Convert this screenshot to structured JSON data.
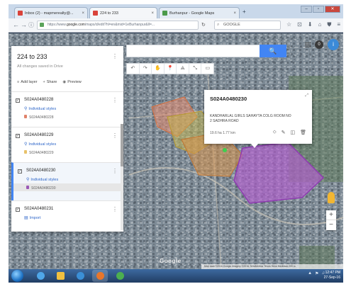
{
  "browser": {
    "tabs": [
      {
        "label": "Inbox (2) - mapmerealty@...",
        "color": "#d9433a"
      },
      {
        "label": "224 to 233",
        "color": "#d9433a"
      },
      {
        "label": "Burhanpur - Google Maps",
        "color": "#4b9a4b"
      }
    ],
    "new_tab": "+",
    "window_buttons": [
      "–",
      "▫",
      "✕"
    ],
    "url_prefix": "https://www.",
    "url_domain": "google.com",
    "url_rest": "/maps/d/edit?hl=en&mid=1eBurhanpur&ll=...",
    "search_placeholder": "GOOGLE",
    "toolbar_icons": [
      "☆",
      "⊡",
      "⬇",
      "⌂",
      "⛊",
      "≡"
    ]
  },
  "map": {
    "search_button": "🔍",
    "tools": [
      "↶",
      "↷",
      "✋",
      "📍",
      "⟁",
      "⤡",
      "▭"
    ],
    "notification_count": "0",
    "avatar_initial": "i",
    "zoom_in": "+",
    "zoom_out": "−",
    "logo": "Google",
    "attribution": "Map data ©2016 Google  Imagery ©2016 TerraMetrics  Terms  Send feedback  200 m"
  },
  "panel": {
    "title": "224 to 233",
    "subtitle": "All changes saved in Drive",
    "menu_icon": "⋮",
    "actions": [
      {
        "icon": "≡",
        "label": "Add layer"
      },
      {
        "icon": "+",
        "label": "Share"
      },
      {
        "icon": "◉",
        "label": "Preview"
      }
    ],
    "layers": [
      {
        "name": "S024A0480228",
        "style": "Individual styles",
        "item": "S024A0480228",
        "color": "#e0826a",
        "selected": false
      },
      {
        "name": "S024A0480229",
        "style": "Individual styles",
        "item": "S024A0480229",
        "color": "#e8c26a",
        "selected": false
      },
      {
        "name": "S024A0480230",
        "style": "Individual styles",
        "item": "S024A0480230",
        "color": "#9b59b6",
        "selected": true
      },
      {
        "name": "S024A0480231",
        "style": "Import",
        "item": "",
        "color": "#2f67c9",
        "selected": false
      }
    ]
  },
  "card": {
    "title": "S024A0480230",
    "description": "KANDHARLAL GIRLS SAHAYTA COLG ROOM NO 2 SADHRA ROAD",
    "meta": "19.6 ha  1.77 km",
    "actions": [
      "⬦",
      "✎",
      "◫",
      "🗑"
    ],
    "expand_icon": "⤢"
  },
  "taskbar": {
    "apps": [
      {
        "name": "ie",
        "color": "#4fa6e8"
      },
      {
        "name": "explorer",
        "color": "#f0c040"
      },
      {
        "name": "media",
        "color": "#3b8fd6"
      },
      {
        "name": "firefox",
        "color": "#e8762c"
      },
      {
        "name": "chrome",
        "color": "#4caf50"
      }
    ],
    "tray_icons": [
      "▲",
      "⚑",
      "♫"
    ],
    "time": "12:47 PM",
    "date": "27-Sep-16"
  }
}
